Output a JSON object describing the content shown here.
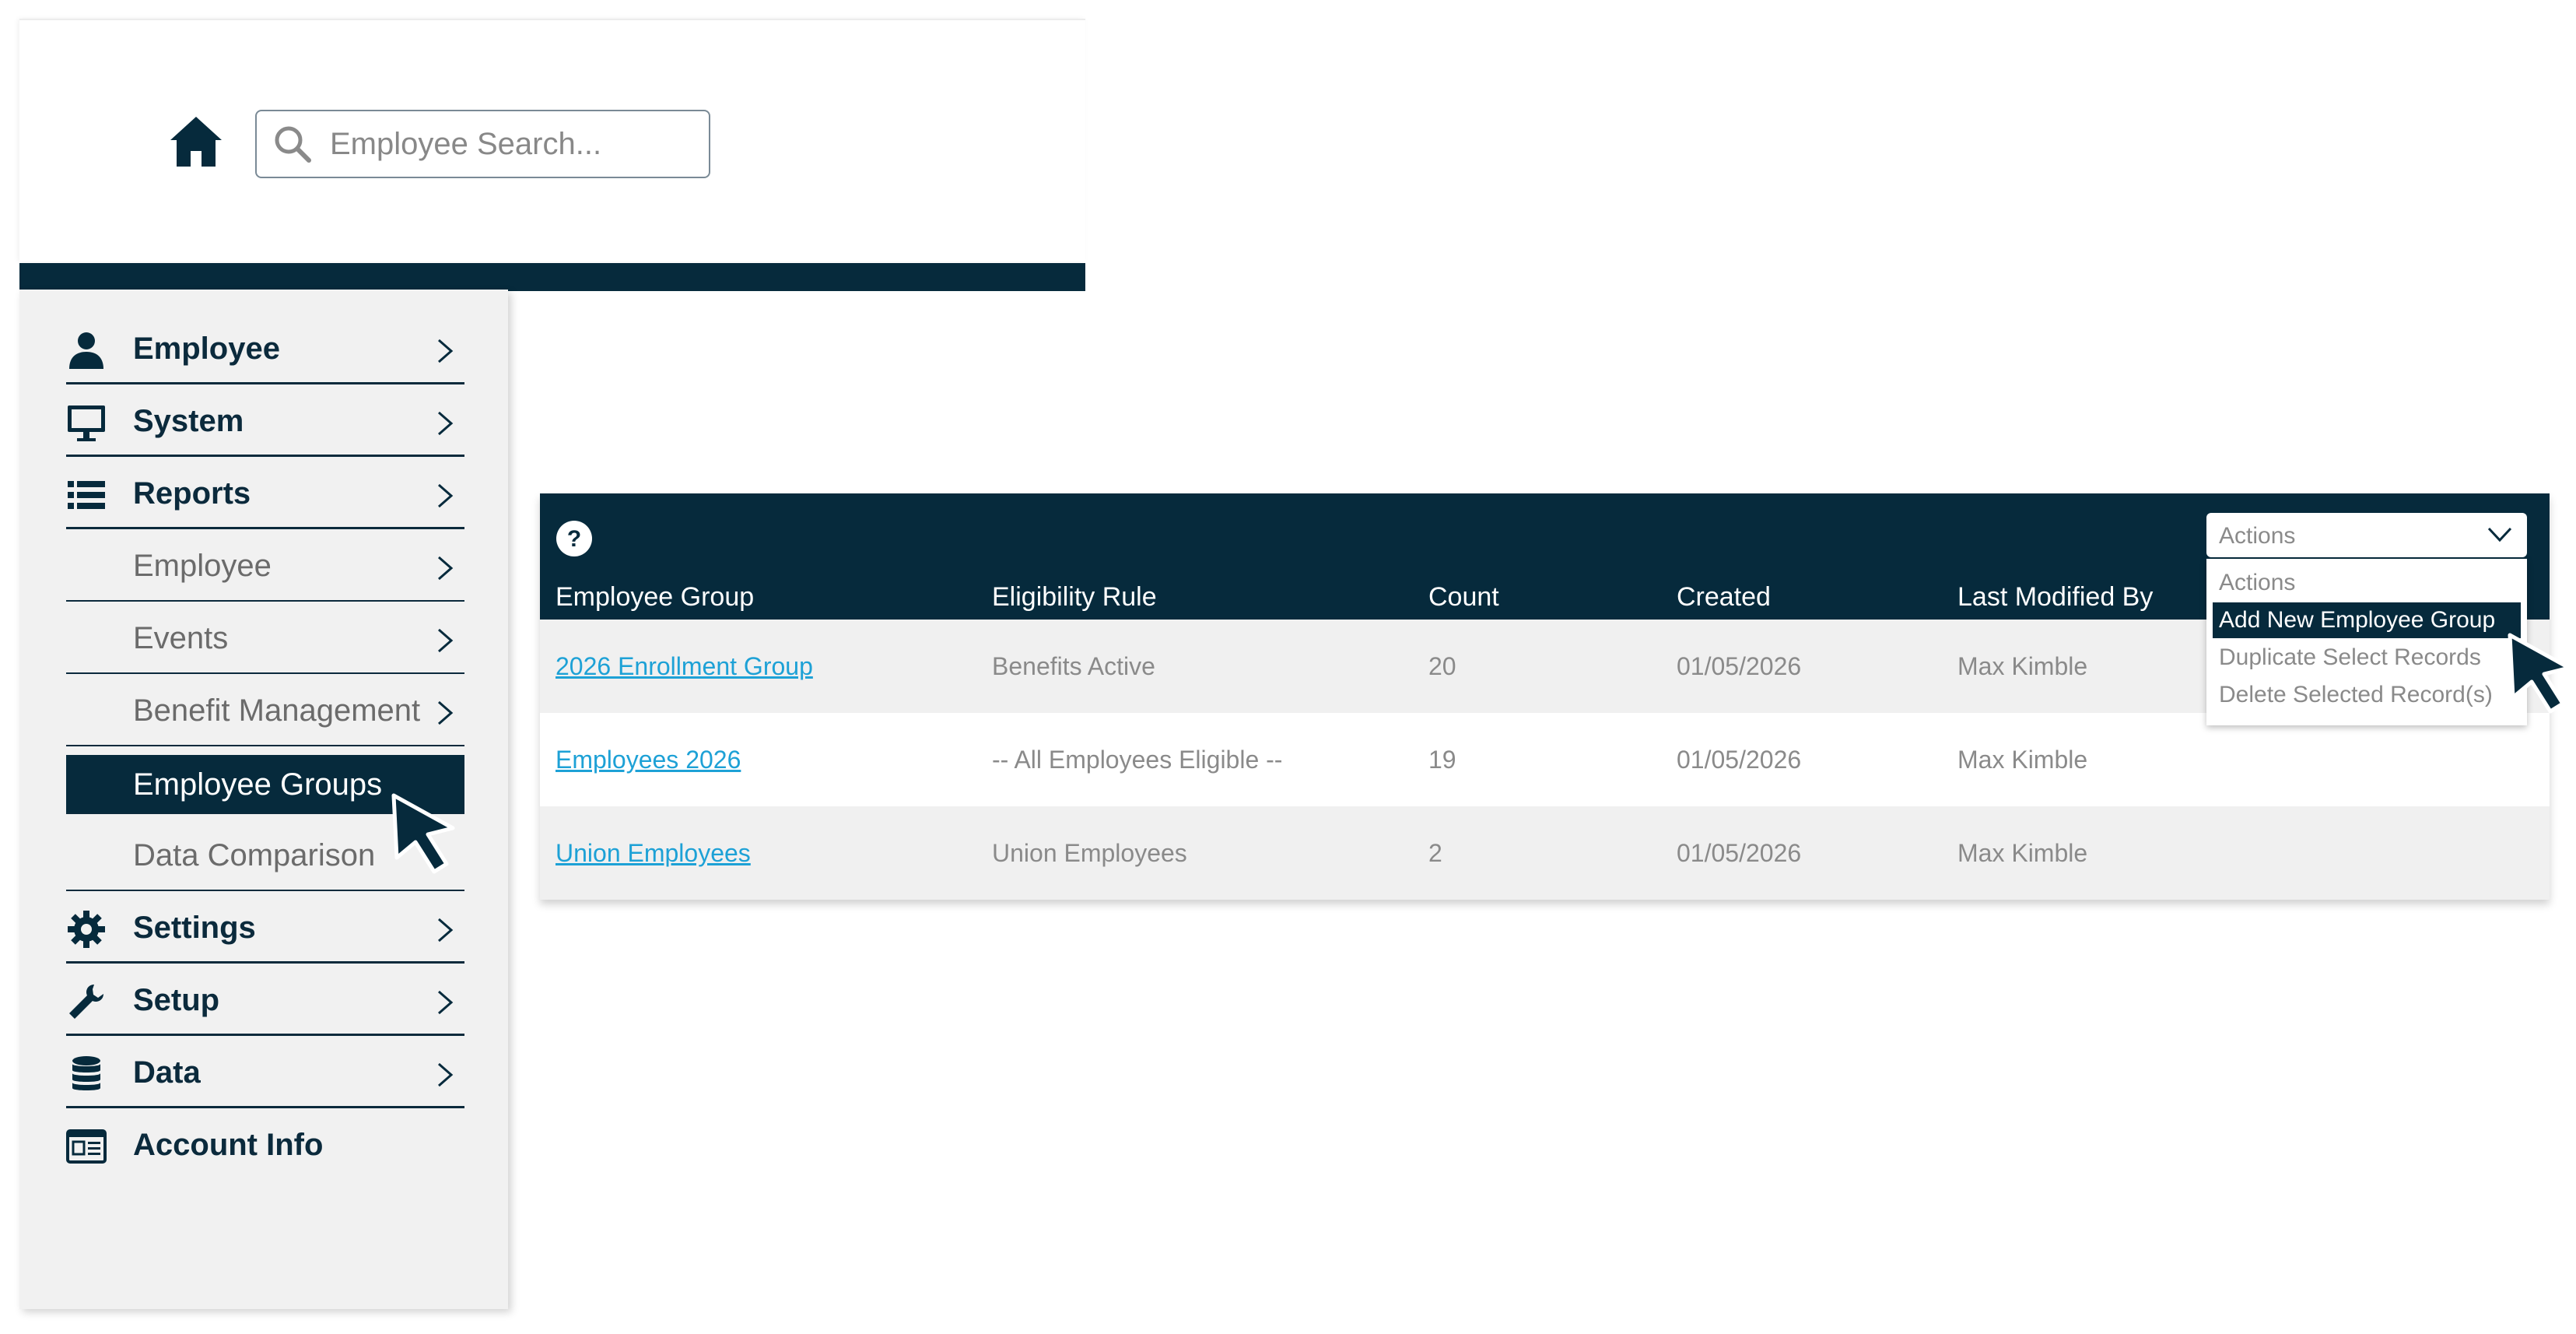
{
  "search": {
    "placeholder": "Employee Search..."
  },
  "icons": {
    "home": "home-icon",
    "search": "magnifier-icon",
    "help": "question-icon"
  },
  "colors": {
    "primary": "#062a3c",
    "link": "#1da1d6",
    "muted": "#8a8a8a",
    "row_alt": "#f0f0f0"
  },
  "sidebar": {
    "items": [
      {
        "label": "Employee",
        "icon": "person-icon"
      },
      {
        "label": "System",
        "icon": "monitor-icon"
      },
      {
        "label": "Reports",
        "icon": "list-icon"
      },
      {
        "label": "Employee"
      },
      {
        "label": "Events"
      },
      {
        "label": "Benefit Management"
      },
      {
        "label": "Employee Groups",
        "active": true
      },
      {
        "label": "Data Comparison"
      },
      {
        "label": "Settings",
        "icon": "gear-icon"
      },
      {
        "label": "Setup",
        "icon": "wrench-icon"
      },
      {
        "label": "Data",
        "icon": "database-icon"
      },
      {
        "label": "Account Info",
        "icon": "id-card-icon"
      }
    ]
  },
  "table": {
    "columns": [
      "Employee Group",
      "Eligibility Rule",
      "Count",
      "Created",
      "Last Modified By"
    ],
    "rows": [
      {
        "group": "2026 Enrollment Group",
        "rule": "Benefits Active",
        "count": "20",
        "created": "01/05/2026",
        "modified_by": "Max Kimble"
      },
      {
        "group": "Employees 2026",
        "rule": "-- All Employees Eligible --",
        "count": "19",
        "created": "01/05/2026",
        "modified_by": "Max Kimble"
      },
      {
        "group": "Union Employees",
        "rule": "Union Employees",
        "count": "2",
        "created": "01/05/2026",
        "modified_by": "Max Kimble"
      }
    ]
  },
  "actions": {
    "selected": "Actions",
    "options": [
      "Actions",
      "Add New Employee Group",
      "Duplicate Select Records",
      "Delete Selected Record(s)"
    ],
    "highlighted": "Add New Employee Group"
  }
}
